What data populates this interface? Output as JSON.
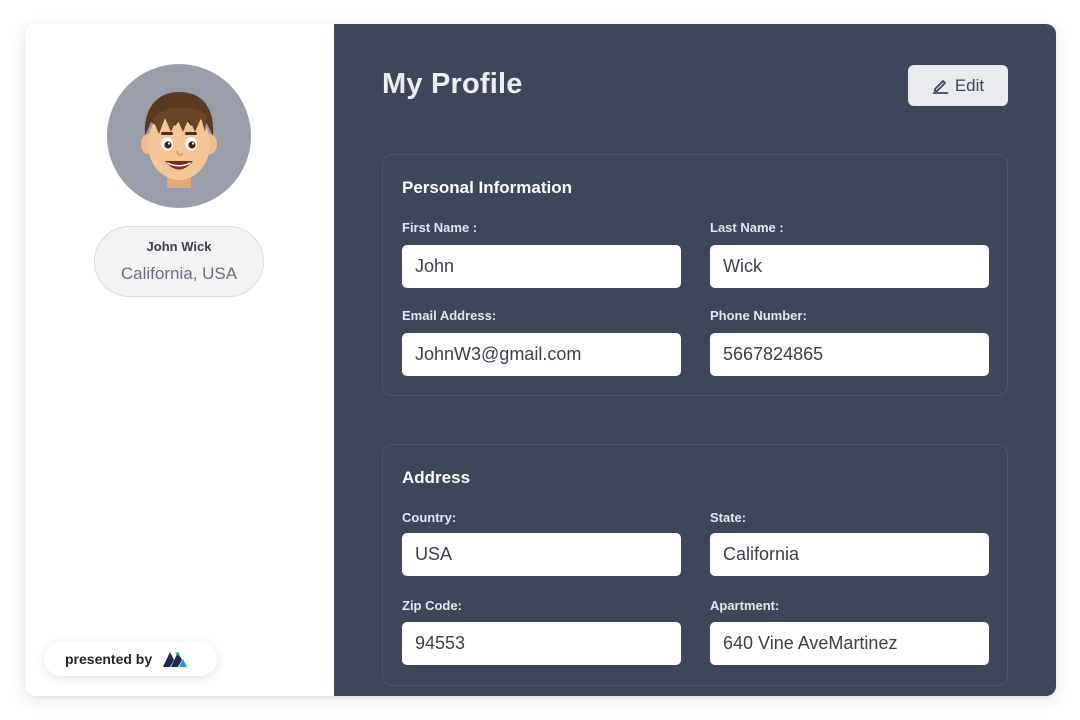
{
  "profile": {
    "name": "John Wick",
    "location": "California, USA"
  },
  "branding": {
    "presented_by": "presented by",
    "logo_icon": "m-logo-icon"
  },
  "header": {
    "title": "My Profile",
    "edit_label": "Edit",
    "edit_icon": "pencil-icon"
  },
  "personal": {
    "title": "Personal Information",
    "first_name": {
      "label": "First Name :",
      "value": "John"
    },
    "last_name": {
      "label": "Last Name :",
      "value": "Wick"
    },
    "email": {
      "label": "Email Address:",
      "value": "JohnW3@gmail.com"
    },
    "phone": {
      "label": "Phone Number:",
      "value": "5667824865"
    }
  },
  "address": {
    "title": "Address",
    "country": {
      "label": "Country:",
      "value": "USA"
    },
    "state": {
      "label": "State:",
      "value": "California"
    },
    "zip": {
      "label": "Zip Code:",
      "value": "94553"
    },
    "apartment": {
      "label": "Apartment:",
      "value": "640 Vine AveMartinez"
    }
  },
  "colors": {
    "panel_bg": "#3e4659",
    "sidebar_bg": "#ffffff",
    "input_bg": "#ffffff",
    "text_light": "#eceef2",
    "avatar_bg": "#9a9eab",
    "logo_dark": "#1e2a4a",
    "logo_blue": "#2d8ff0"
  }
}
